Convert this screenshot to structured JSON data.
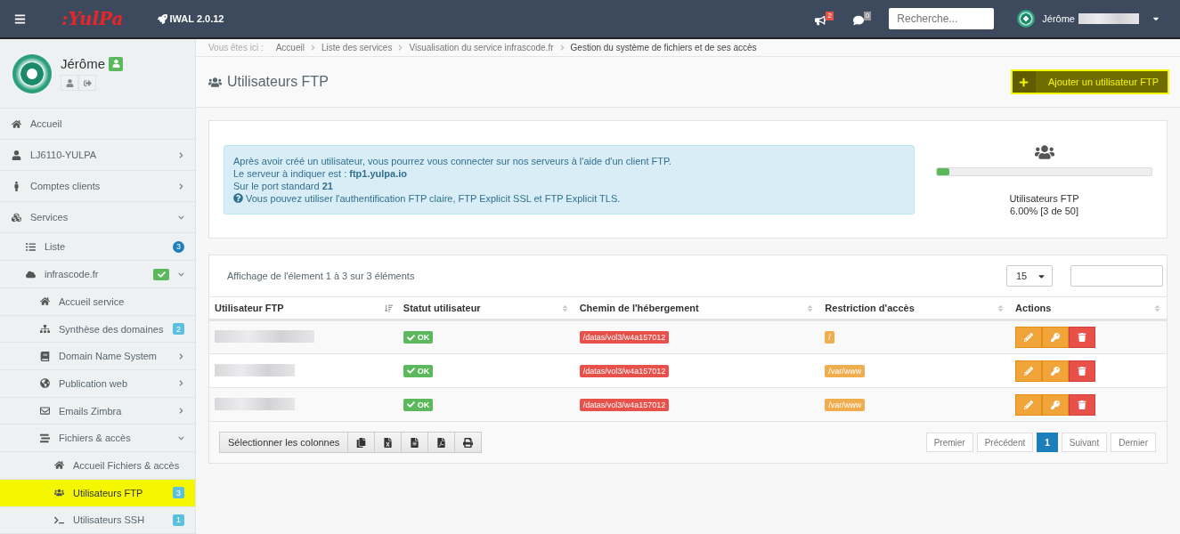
{
  "topbar": {
    "logo": ":YulPa",
    "version": "IWAL 2.0.12",
    "notifications": "2",
    "messages": "0",
    "search": {
      "placeholder": "Recherche..."
    },
    "user": "Jérôme"
  },
  "profile": {
    "name": "Jérôme"
  },
  "sidebar": {
    "items": [
      {
        "label": "Accueil",
        "selected": false
      },
      {
        "label": "LJ6110-YULPA",
        "selected": false,
        "expanded": false
      },
      {
        "label": "Comptes clients",
        "selected": false,
        "expanded": false
      },
      {
        "label": "Services",
        "selected": false,
        "expanded": true,
        "children": [
          {
            "label": "Liste",
            "selected": false,
            "badge": {
              "text": "3",
              "color": "#1c7ebb",
              "kind": "round"
            }
          },
          {
            "label": "infrascode.fr",
            "selected": false,
            "expanded": true,
            "badge": {
              "color": "#5cb85c",
              "kind": "check"
            },
            "children": [
              {
                "label": "Accueil service",
                "selected": false
              },
              {
                "label": "Synthèse des domaines",
                "selected": false,
                "badge": {
                  "text": "2",
                  "color": "#5bc0de",
                  "kind": "square"
                }
              },
              {
                "label": "Domain Name System",
                "selected": false,
                "expanded": false
              },
              {
                "label": "Publication web",
                "selected": false,
                "expanded": false
              },
              {
                "label": "Emails Zimbra",
                "selected": false,
                "expanded": false
              },
              {
                "label": "Fichiers & accès",
                "selected": false,
                "expanded": true,
                "children": [
                  {
                    "label": "Accueil Fichiers & accès",
                    "selected": false
                  },
                  {
                    "label": "Utilisateurs FTP",
                    "selected": true,
                    "badge": {
                      "text": "3",
                      "color": "#5bc0de",
                      "kind": "square"
                    }
                  },
                  {
                    "label": "Utilisateurs SSH",
                    "selected": false,
                    "badge": {
                      "text": "1",
                      "color": "#5bc0de",
                      "kind": "square"
                    }
                  }
                ]
              }
            ]
          }
        ]
      }
    ]
  },
  "breadcrumb": {
    "label": "Vous êtes ici :",
    "items": [
      "Accueil",
      "Liste des services",
      "Visualisation du service infrascode.fr",
      "Gestion du système de fichiers et de ses accès"
    ]
  },
  "page": {
    "title": "Utilisateurs FTP",
    "add_button": "Ajouter un utilisateur FTP"
  },
  "info": {
    "lines": [
      "Après avoir créé un utilisateur, vous pourrez vous connecter sur nos serveurs à l'aide d'un client FTP.",
      "Le serveur à indiquer est : **ftp1.yulpa.io**",
      "Sur le port standard **21**"
    ],
    "note": "Vous pouvez utiliser l'authentification FTP claire, FTP Explicit SSL et FTP Explicit TLS."
  },
  "quota": {
    "label": "Utilisateurs FTP",
    "reading": "6.00% [3 de 50]",
    "level": 0.06
  },
  "table": {
    "summary": "Affichage de l'élement 1 à 3 sur 3 éléments",
    "page_size": "15",
    "columns": [
      {
        "label": "Utilisateur FTP",
        "sorted": true
      },
      {
        "label": "Statut utilisateur",
        "sorted": false
      },
      {
        "label": "Chemin de l'hébergement",
        "sorted": false
      },
      {
        "label": "Restriction d'accès",
        "sorted": false
      },
      {
        "label": "Actions",
        "sorted": false
      }
    ],
    "rows": [
      {
        "status": "OK",
        "path": "/datas/vol3/w4a157012",
        "restriction": "/"
      },
      {
        "status": "OK",
        "path": "/datas/vol3/w4a157012",
        "restriction": "/var/www"
      },
      {
        "status": "OK",
        "path": "/datas/vol3/w4a157012",
        "restriction": "/var/www"
      }
    ],
    "columns_button": "Sélectionner les colonnes",
    "pages": [
      {
        "label": "Premier",
        "selected": false
      },
      {
        "label": "Précédent",
        "selected": false
      },
      {
        "label": "1",
        "selected": true
      },
      {
        "label": "Suivant",
        "selected": false
      },
      {
        "label": "Dernier",
        "selected": false
      }
    ]
  }
}
